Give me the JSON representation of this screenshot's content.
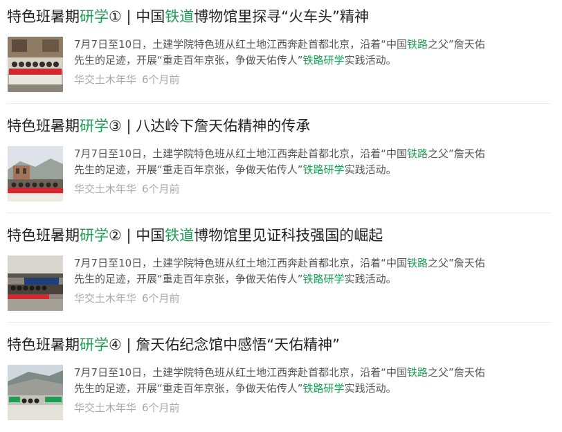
{
  "colors": {
    "highlight": "#1f9d55",
    "title": "#222222",
    "summary": "#555555",
    "meta": "#a8a8a8"
  },
  "articles": [
    {
      "title": {
        "pre": "特色班暑期",
        "hl1": "研学",
        "mid": "① | 中国",
        "hl2": "铁道",
        "post": "博物馆里探寻“火车头”精神"
      },
      "thumbnail_icon": "group-photo-image",
      "summary": {
        "l1_pre": "7月7日至10日，土建学院特色班从红土地江西奔赴首都北京，沿着“中国",
        "l1_hl": "铁路",
        "l1_post": "之父”詹天佑",
        "l2_pre": "先生的足迹，开展“重走百年京张，争做天佑传人”",
        "l2_hl": "铁路研学",
        "l2_post": "实践活动。"
      },
      "source": "华交土木年华",
      "time": "6个月前"
    },
    {
      "title": {
        "pre": "特色班暑期",
        "hl1": "研学",
        "mid": "③ | 八达岭下詹天佑精神的传承",
        "hl2": "",
        "post": ""
      },
      "thumbnail_icon": "group-photo-image",
      "summary": {
        "l1_pre": "7月7日至10日，土建学院特色班从红土地江西奔赴首都北京，沿着“中国",
        "l1_hl": "铁路",
        "l1_post": "之父”詹天佑",
        "l2_pre": "先生的足迹，开展“重走百年京张，争做天佑传人”",
        "l2_hl": "铁路研学",
        "l2_post": "实践活动。"
      },
      "source": "华交土木年华",
      "time": "6个月前"
    },
    {
      "title": {
        "pre": "特色班暑期",
        "hl1": "研学",
        "mid": "② | 中国",
        "hl2": "铁道",
        "post": "博物馆里见证科技强国的崛起"
      },
      "thumbnail_icon": "group-photo-image",
      "summary": {
        "l1_pre": "7月7日至10日，土建学院特色班从红土地江西奔赴首都北京，沿着“中国",
        "l1_hl": "铁路",
        "l1_post": "之父”詹天佑",
        "l2_pre": "先生的足迹，开展“重走百年京张，争做天佑传人”",
        "l2_hl": "铁路研学",
        "l2_post": "实践活动。"
      },
      "source": "华交土木年华",
      "time": "6个月前"
    },
    {
      "title": {
        "pre": "特色班暑期",
        "hl1": "研学",
        "mid": "④ | 詹天佑纪念馆中感悟“天佑精神”",
        "hl2": "",
        "post": ""
      },
      "thumbnail_icon": "group-photo-image",
      "summary": {
        "l1_pre": "7月7日至10日，土建学院特色班从红土地江西奔赴首都北京，沿着“中国",
        "l1_hl": "铁路",
        "l1_post": "之父”詹天佑",
        "l2_pre": "先生的足迹，开展“重走百年京张，争做天佑传人”",
        "l2_hl": "铁路研学",
        "l2_post": "实践活动。"
      },
      "source": "华交土木年华",
      "time": "6个月前"
    }
  ]
}
